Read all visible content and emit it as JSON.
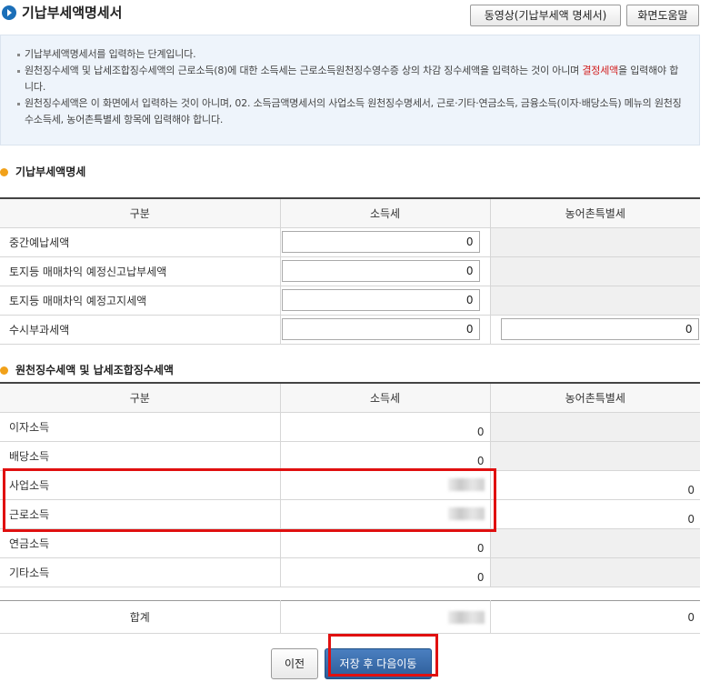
{
  "header": {
    "title": "기납부세액명세서",
    "video_button": "동영상(기납부세액 명세서)",
    "help_button": "화면도움말"
  },
  "notice": {
    "line1": "기납부세액명세서를 입력하는 단계입니다.",
    "line2_a": "원천징수세액 및 납세조합징수세액의 근로소득(8)에 대한 소득세는 근로소득원천징수영수증 상의 차감 징수세액을 입력하는 것이 아니며 ",
    "line2_red": "결정세액",
    "line2_b": "을 입력해야 합니다.",
    "line3": "원천징수세액은 이 화면에서 입력하는 것이 아니며, 02. 소득금액명세서의 사업소득 원천징수명세서, 근로·기타·연금소득, 금융소득(이자·배당소득) 메뉴의 원천징수소득세, 농어촌특별세 항목에 입력해야 합니다."
  },
  "section1": {
    "title": "기납부세액명세",
    "headers": [
      "구분",
      "소득세",
      "농어촌특별세"
    ],
    "rows": [
      {
        "label": "중간예납세액",
        "income_tax": "0",
        "rural_tax": ""
      },
      {
        "label": "토지등 매매차익 예정신고납부세액",
        "income_tax": "0",
        "rural_tax": ""
      },
      {
        "label": "토지등 매매차익 예정고지세액",
        "income_tax": "0",
        "rural_tax": ""
      },
      {
        "label": "수시부과세액",
        "income_tax": "0",
        "rural_tax": "0"
      }
    ]
  },
  "section2": {
    "title": "원천징수세액 및 납세조합징수세액",
    "headers": [
      "구분",
      "소득세",
      "농어촌특별세"
    ],
    "rows": [
      {
        "label": "이자소득",
        "income_tax": "0",
        "rural_tax": ""
      },
      {
        "label": "배당소득",
        "income_tax": "0",
        "rural_tax": ""
      },
      {
        "label": "사업소득",
        "income_tax": "",
        "rural_tax": "0"
      },
      {
        "label": "근로소득",
        "income_tax": "",
        "rural_tax": "0"
      },
      {
        "label": "연금소득",
        "income_tax": "0",
        "rural_tax": ""
      },
      {
        "label": "기타소득",
        "income_tax": "0",
        "rural_tax": ""
      }
    ]
  },
  "total": {
    "label": "합계",
    "rural_tax": "0"
  },
  "footer": {
    "prev_button": "이전",
    "save_button": "저장 후 다음이동"
  },
  "colors": {
    "accent_blue": "#2d5d99",
    "highlight_red": "#e01010",
    "section_dot": "#f1a11a",
    "notice_bg": "#eef4fb"
  }
}
